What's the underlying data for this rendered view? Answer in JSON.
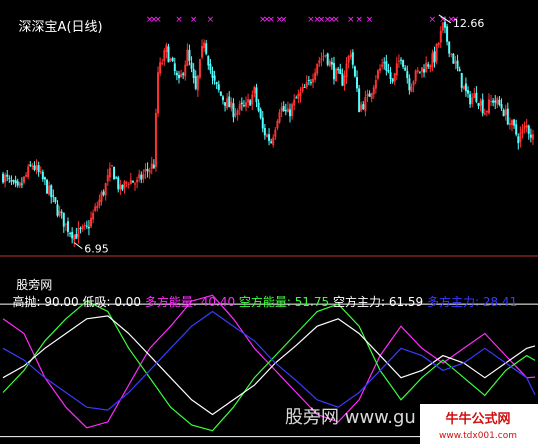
{
  "upper_panel": {
    "title": "深深宝A",
    "period": "(日线)",
    "high_label": "12.66",
    "low_label": "6.95",
    "marker_glyph": "×"
  },
  "lower_panel": {
    "indicator_name": "股旁网",
    "items": [
      {
        "label": "高抛:",
        "value": "90.00",
        "color": "#FFFFFF"
      },
      {
        "label": "低吸:",
        "value": "0.00",
        "color": "#FFFFFF"
      },
      {
        "label": "多方能量:",
        "value": "40.40",
        "color": "#FF2BFF"
      },
      {
        "label": "空方能量:",
        "value": "51.75",
        "color": "#3CFF3C"
      },
      {
        "label": "空方主力:",
        "value": "61.59",
        "color": "#FFFFFF"
      },
      {
        "label": "多方主力:",
        "value": "28.41",
        "color": "#3A3AFF"
      }
    ]
  },
  "watermarks": {
    "center": "股旁网 www.gu",
    "corner_main": "牛牛公式网",
    "corner_url": "www.tdx001.com"
  },
  "colors": {
    "background": "#000000",
    "up_candle": "#FF3232",
    "down_candle": "#54FFFF",
    "marker": "#FF2BFF",
    "divider": "#C83232",
    "high_line": "#FFFFFF",
    "low_line": "#FFFFFF"
  },
  "chart_data": [
    {
      "type": "candlestick",
      "title": "深深宝A (日线)",
      "ylim": [
        6.6,
        13.0
      ],
      "annotations": [
        {
          "text": "12.66",
          "value": 12.66
        },
        {
          "text": "6.95",
          "value": 6.95
        }
      ],
      "close_path": [
        [
          0,
          8.6
        ],
        [
          7,
          8.2
        ],
        [
          14,
          8.9
        ],
        [
          20,
          8.4
        ],
        [
          26,
          7.7
        ],
        [
          30,
          7.3
        ],
        [
          34,
          7.05
        ],
        [
          40,
          7.2
        ],
        [
          44,
          7.7
        ],
        [
          48,
          8.2
        ],
        [
          52,
          8.8
        ],
        [
          56,
          8.2
        ],
        [
          60,
          8.5
        ],
        [
          64,
          8.4
        ],
        [
          68,
          8.7
        ],
        [
          72,
          8.9
        ],
        [
          74,
          11.3
        ],
        [
          78,
          11.9
        ],
        [
          84,
          11.0
        ],
        [
          88,
          11.8
        ],
        [
          92,
          10.8
        ],
        [
          96,
          12.2
        ],
        [
          100,
          11.1
        ],
        [
          104,
          10.7
        ],
        [
          110,
          10.3
        ],
        [
          116,
          10.4
        ],
        [
          120,
          10.8
        ],
        [
          124,
          9.8
        ],
        [
          128,
          9.5
        ],
        [
          132,
          10.4
        ],
        [
          136,
          10.2
        ],
        [
          140,
          10.6
        ],
        [
          146,
          11.0
        ],
        [
          150,
          11.6
        ],
        [
          154,
          11.8
        ],
        [
          158,
          11.3
        ],
        [
          162,
          11.1
        ],
        [
          166,
          11.9
        ],
        [
          170,
          10.4
        ],
        [
          174,
          10.6
        ],
        [
          178,
          11.2
        ],
        [
          182,
          11.6
        ],
        [
          186,
          11.0
        ],
        [
          190,
          11.8
        ],
        [
          194,
          11.0
        ],
        [
          198,
          11.3
        ],
        [
          202,
          11.5
        ],
        [
          206,
          11.7
        ],
        [
          210,
          12.5
        ],
        [
          214,
          11.8
        ],
        [
          218,
          11.2
        ],
        [
          222,
          10.6
        ],
        [
          226,
          10.7
        ],
        [
          230,
          10.3
        ],
        [
          234,
          10.6
        ],
        [
          238,
          10.4
        ],
        [
          242,
          10.0
        ],
        [
          246,
          9.6
        ],
        [
          250,
          9.9
        ],
        [
          253,
          9.6
        ]
      ],
      "candle_count": 254,
      "marker_count": 36
    },
    {
      "type": "line",
      "title": "股旁网",
      "ylim": [
        -5,
        105
      ],
      "reference_lines": [
        {
          "name": "高抛",
          "value": 90,
          "color": "#FFFFFF"
        },
        {
          "name": "低吸",
          "value": 0,
          "color": "#FFFFFF"
        }
      ],
      "series": [
        {
          "name": "多方能量",
          "color": "#FF2BFF",
          "last": 40.4,
          "points": [
            [
              0,
              80
            ],
            [
              10,
              70
            ],
            [
              20,
              40
            ],
            [
              30,
              20
            ],
            [
              40,
              6
            ],
            [
              50,
              10
            ],
            [
              60,
              35
            ],
            [
              70,
              60
            ],
            [
              80,
              75
            ],
            [
              90,
              92
            ],
            [
              100,
              96
            ],
            [
              110,
              80
            ],
            [
              120,
              60
            ],
            [
              130,
              45
            ],
            [
              140,
              30
            ],
            [
              150,
              15
            ],
            [
              160,
              10
            ],
            [
              170,
              25
            ],
            [
              180,
              55
            ],
            [
              190,
              75
            ],
            [
              200,
              60
            ],
            [
              210,
              50
            ],
            [
              220,
              60
            ],
            [
              230,
              70
            ],
            [
              240,
              55
            ],
            [
              250,
              40
            ],
            [
              254,
              40.4
            ]
          ]
        },
        {
          "name": "空方能量",
          "color": "#3CFF3C",
          "last": 51.75,
          "points": [
            [
              0,
              30
            ],
            [
              10,
              45
            ],
            [
              20,
              65
            ],
            [
              30,
              80
            ],
            [
              40,
              92
            ],
            [
              50,
              85
            ],
            [
              60,
              60
            ],
            [
              70,
              40
            ],
            [
              80,
              20
            ],
            [
              90,
              8
            ],
            [
              100,
              4
            ],
            [
              110,
              20
            ],
            [
              120,
              40
            ],
            [
              130,
              55
            ],
            [
              140,
              70
            ],
            [
              150,
              85
            ],
            [
              160,
              90
            ],
            [
              170,
              75
            ],
            [
              180,
              45
            ],
            [
              190,
              25
            ],
            [
              200,
              40
            ],
            [
              210,
              52
            ],
            [
              220,
              40
            ],
            [
              230,
              28
            ],
            [
              240,
              45
            ],
            [
              250,
              55
            ],
            [
              254,
              51.75
            ]
          ]
        },
        {
          "name": "空方主力",
          "color": "#FFFFFF",
          "last": 61.59,
          "points": [
            [
              0,
              40
            ],
            [
              10,
              48
            ],
            [
              20,
              60
            ],
            [
              30,
              70
            ],
            [
              40,
              80
            ],
            [
              50,
              82
            ],
            [
              60,
              70
            ],
            [
              70,
              55
            ],
            [
              80,
              40
            ],
            [
              90,
              25
            ],
            [
              100,
              15
            ],
            [
              110,
              25
            ],
            [
              120,
              35
            ],
            [
              130,
              50
            ],
            [
              140,
              62
            ],
            [
              150,
              75
            ],
            [
              160,
              80
            ],
            [
              170,
              70
            ],
            [
              180,
              55
            ],
            [
              190,
              40
            ],
            [
              200,
              45
            ],
            [
              210,
              55
            ],
            [
              220,
              50
            ],
            [
              230,
              40
            ],
            [
              240,
              50
            ],
            [
              250,
              60
            ],
            [
              254,
              61.59
            ]
          ]
        },
        {
          "name": "多方主力",
          "color": "#3A3AFF",
          "last": 28.41,
          "points": [
            [
              0,
              60
            ],
            [
              10,
              52
            ],
            [
              20,
              40
            ],
            [
              30,
              30
            ],
            [
              40,
              20
            ],
            [
              50,
              18
            ],
            [
              60,
              30
            ],
            [
              70,
              45
            ],
            [
              80,
              60
            ],
            [
              90,
              75
            ],
            [
              100,
              85
            ],
            [
              110,
              75
            ],
            [
              120,
              65
            ],
            [
              130,
              50
            ],
            [
              140,
              38
            ],
            [
              150,
              25
            ],
            [
              160,
              20
            ],
            [
              170,
              30
            ],
            [
              180,
              45
            ],
            [
              190,
              60
            ],
            [
              200,
              55
            ],
            [
              210,
              45
            ],
            [
              220,
              50
            ],
            [
              230,
              60
            ],
            [
              240,
              50
            ],
            [
              250,
              40
            ],
            [
              254,
              28.41
            ]
          ]
        }
      ]
    }
  ]
}
